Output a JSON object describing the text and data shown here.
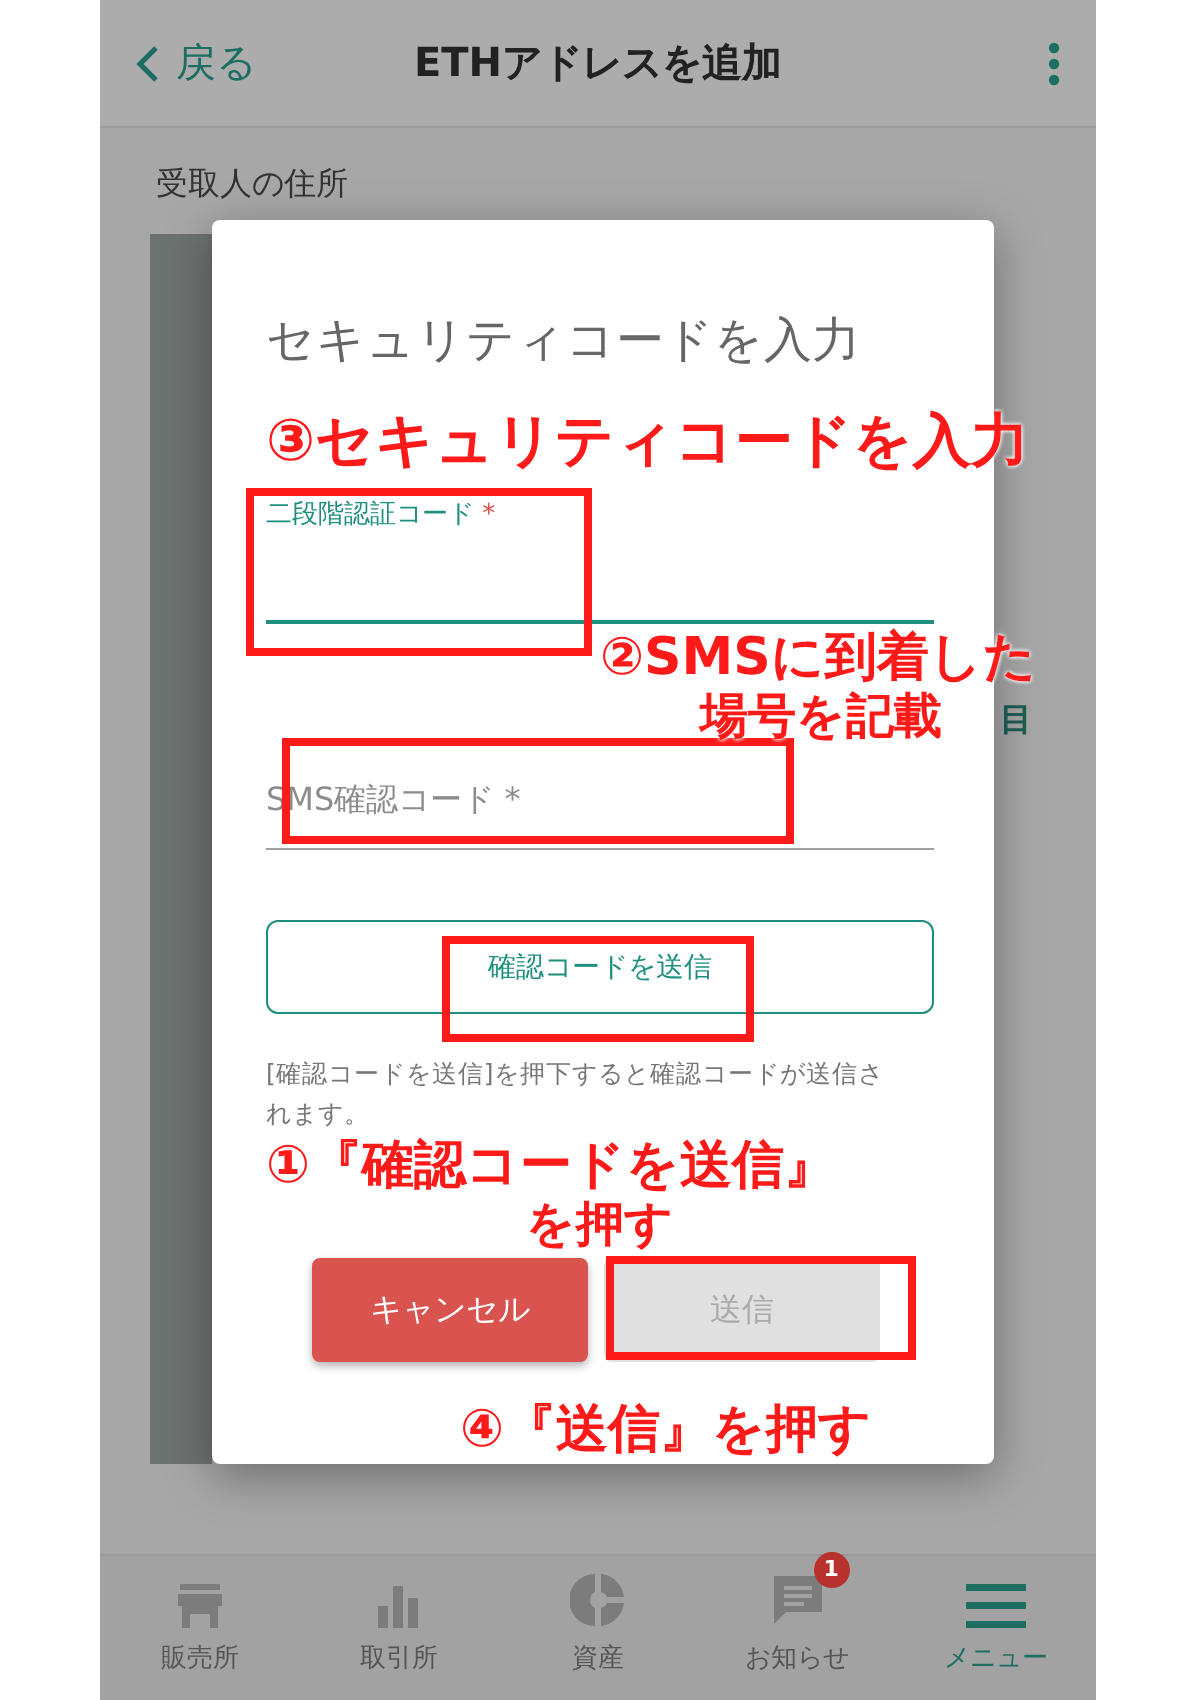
{
  "header": {
    "back": "戻る",
    "title": "ETHアドレスを追加"
  },
  "background": {
    "section_label": "受取人の住所",
    "fragment": "目"
  },
  "dialog": {
    "title": "セキュリティコードを入力",
    "fields": [
      {
        "label": "二段階認証コード",
        "required_mark": "*",
        "focused": true,
        "highlighted": true
      },
      {
        "placeholder": "SMS確認コード *",
        "focused": false,
        "highlighted": true
      }
    ],
    "send_code_button": {
      "label": "確認コードを送信",
      "highlighted": true
    },
    "note": "[確認コードを送信]を押下すると確認コードが送信されます。",
    "actions": [
      {
        "label": "キャンセル",
        "kind": "cancel",
        "disabled": false,
        "highlighted": false
      },
      {
        "label": "送信",
        "kind": "submit",
        "disabled": true,
        "highlighted": true
      }
    ]
  },
  "annotations": [
    {
      "text": "③セキュリティコードを入力"
    },
    {
      "text": "②SMSに到着した"
    },
    {
      "text": "場号を記載"
    },
    {
      "text": "①『確認コードを送信』"
    },
    {
      "text": "を押す"
    },
    {
      "text": "④『送信』を押す"
    }
  ],
  "nav": [
    {
      "label": "販売所",
      "selected": false
    },
    {
      "label": "取引所",
      "selected": false
    },
    {
      "label": "資産",
      "selected": false
    },
    {
      "label": "お知らせ",
      "selected": false,
      "badge": "1"
    },
    {
      "label": "メニュー",
      "selected": true
    }
  ]
}
